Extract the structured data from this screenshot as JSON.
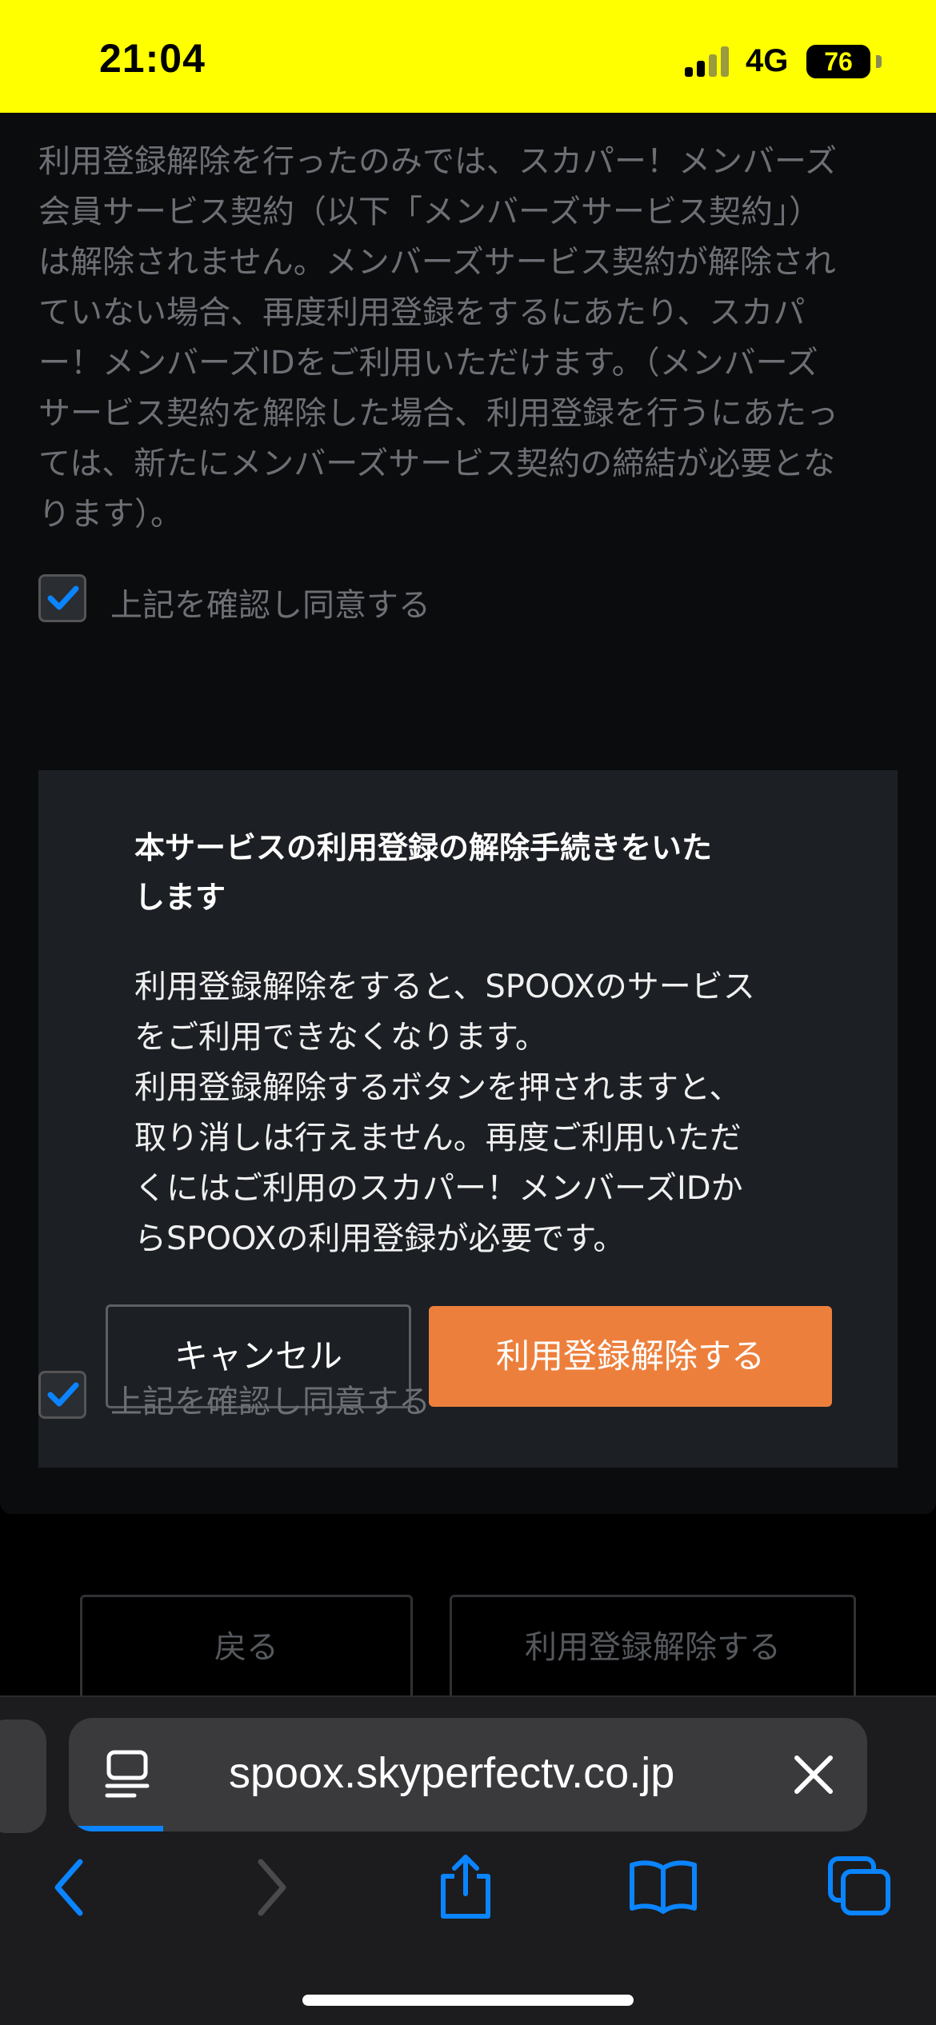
{
  "status_bar": {
    "time": "21:04",
    "network": "4G",
    "battery": "76"
  },
  "terms_paragraph": [
    "利用登録解除を行ったのみでは、スカパー！メンバーズ",
    "会員サービス契約（以下「メンバーズサービス契約」）",
    "は解除されません。メンバーズサービス契約が解除され",
    "ていない場合、再度利用登録をするにあたり、スカパ",
    "ー！メンバーズIDをご利用いただけます。（メンバーズ",
    "サービス契約を解除した場合、利用登録を行うにあたっ",
    "ては、新たにメンバーズサービス契約の締結が必要とな",
    "ります）。"
  ],
  "agree_label": "上記を確認し同意する",
  "dialog": {
    "title": [
      "本サービスの利用登録の解除手続きをいた",
      "します"
    ],
    "body": [
      "利用登録解除をすると、SPOOXのサービス",
      "をご利用できなくなります。",
      "利用登録解除するボタンを押されますと、",
      "取り消しは行えません。再度ご利用いただ",
      "くにはご利用のスカパー！メンバーズIDか",
      "らSPOOXの利用登録が必要です。"
    ],
    "cancel_label": "キャンセル",
    "confirm_label": "利用登録解除する"
  },
  "page_buttons": {
    "back_label": "戻る",
    "unsubscribe_label": "利用登録解除する"
  },
  "browser": {
    "url": "spoox.skyperfectv.co.jp"
  },
  "colors": {
    "status_bar": "#ffff00",
    "accent": "#ed7f3c",
    "checkbox_check": "#0a84ff",
    "link_blue": "#0a84ff"
  },
  "icons": {
    "page_menu": "page-icon",
    "close": "close-icon",
    "back": "chevron-left-icon",
    "forward": "chevron-right-icon",
    "share": "share-icon",
    "bookmarks": "book-icon",
    "tabs": "tabs-icon"
  }
}
